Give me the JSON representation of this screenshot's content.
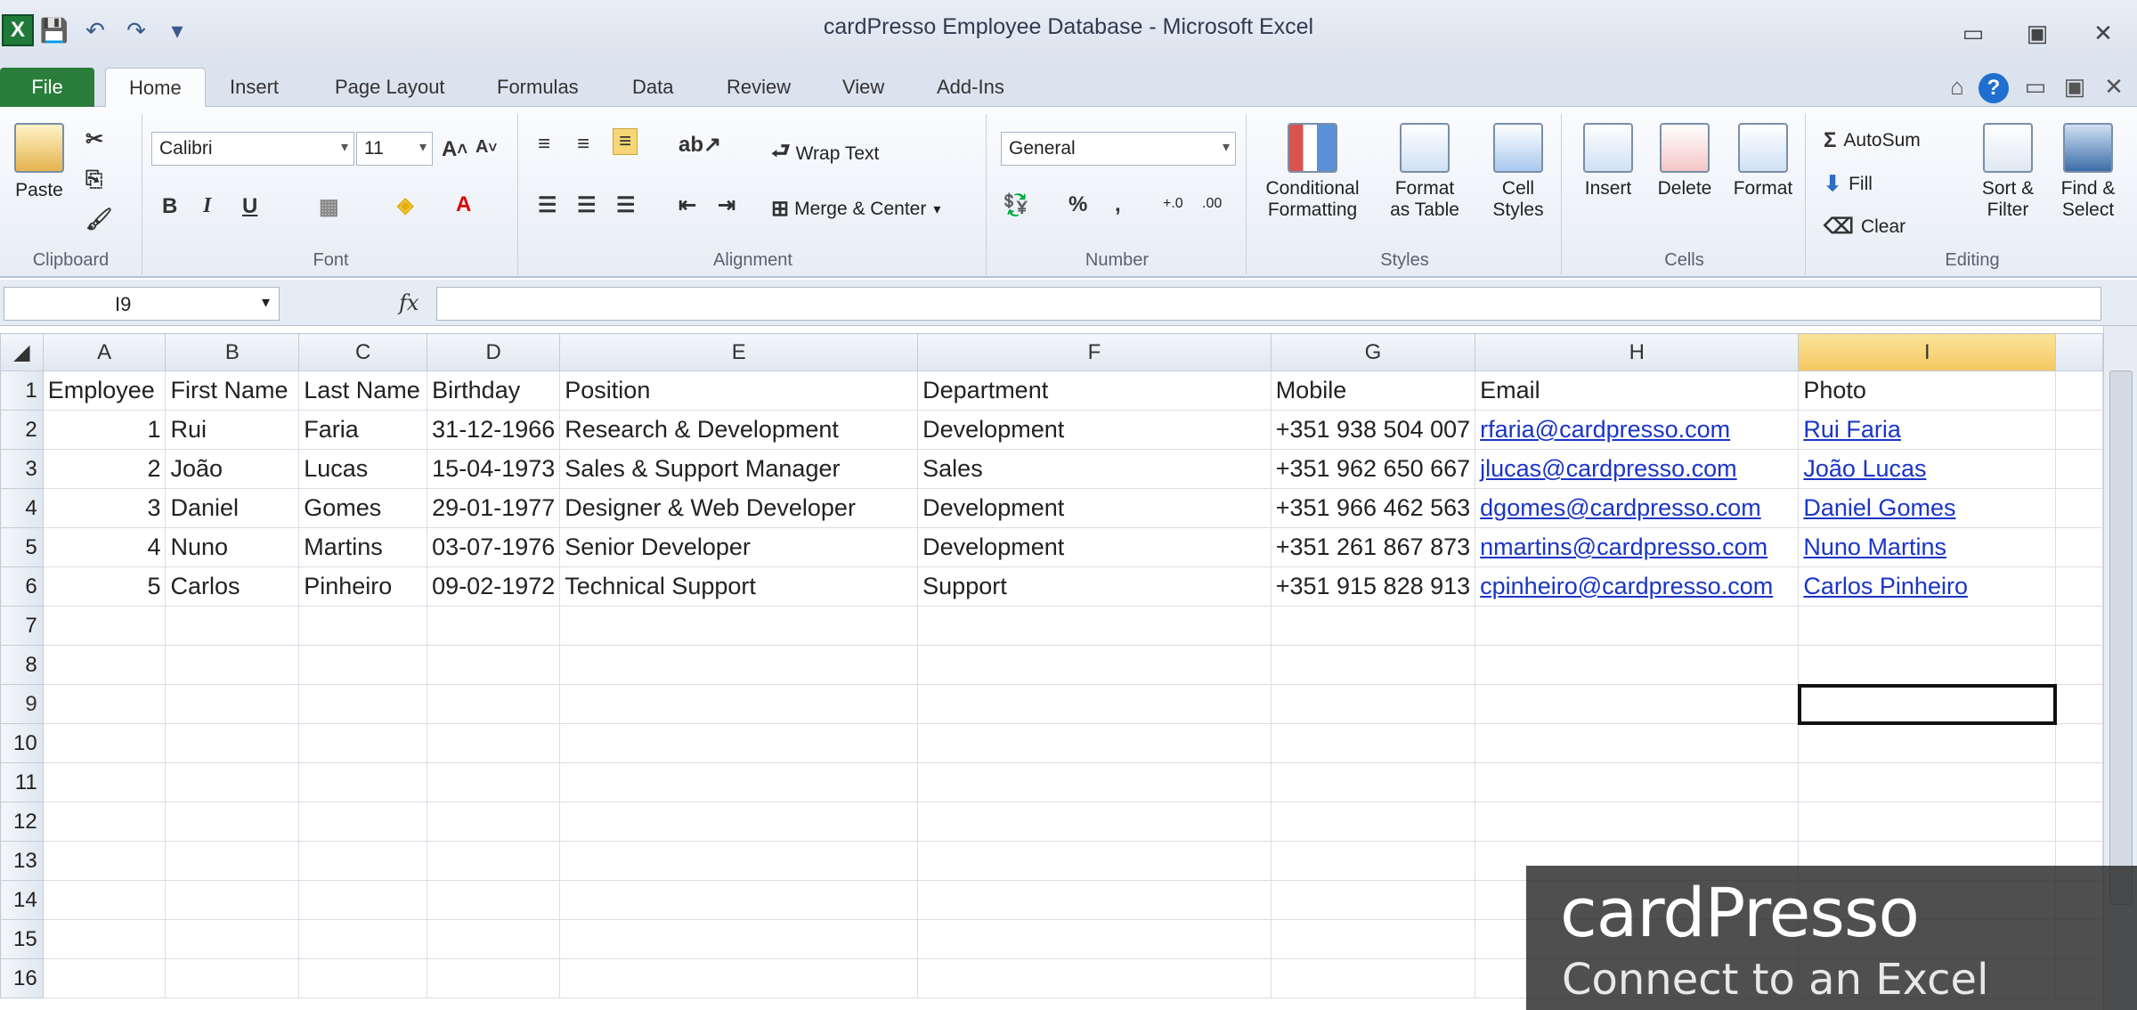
{
  "window": {
    "title": "cardPresso Employee Database  -  Microsoft Excel"
  },
  "tabs": [
    "File",
    "Home",
    "Insert",
    "Page Layout",
    "Formulas",
    "Data",
    "Review",
    "View",
    "Add-Ins"
  ],
  "ribbon": {
    "clipboard": {
      "paste": "Paste",
      "label": "Clipboard"
    },
    "font": {
      "name": "Calibri",
      "size": "11",
      "label": "Font",
      "bold": "B",
      "italic": "I",
      "underline": "U"
    },
    "alignment": {
      "wrap_text": "Wrap Text",
      "merge_center": "Merge & Center",
      "label": "Alignment"
    },
    "number": {
      "format": "General",
      "label": "Number",
      "percent": "%",
      "comma": ","
    },
    "styles": {
      "conditional": "Conditional",
      "conditional2": "Formatting",
      "format_table": "Format",
      "format_table2": "as Table",
      "cell_styles": "Cell",
      "cell_styles2": "Styles",
      "label": "Styles"
    },
    "cells": {
      "insert": "Insert",
      "delete": "Delete",
      "format": "Format",
      "label": "Cells"
    },
    "editing": {
      "autosum": "AutoSum",
      "fill": "Fill",
      "clear": "Clear",
      "sort": "Sort &",
      "sort2": "Filter",
      "find": "Find &",
      "find2": "Select",
      "label": "Editing"
    }
  },
  "formula_bar": {
    "name_box": "I9",
    "fx": "fx",
    "value": ""
  },
  "sheet": {
    "columns": [
      "A",
      "B",
      "C",
      "D",
      "E",
      "F",
      "G",
      "H",
      "I"
    ],
    "row_numbers": [
      "1",
      "2",
      "3",
      "4",
      "5",
      "6",
      "7",
      "8",
      "9",
      "10",
      "11",
      "12",
      "13",
      "14",
      "15",
      "16"
    ],
    "headers": [
      "Employee",
      "First Name",
      "Last Name",
      "Birthday",
      "Position",
      "Department",
      "Mobile",
      "Email",
      "Photo"
    ],
    "rows": [
      [
        "1",
        "Rui",
        "Faria",
        "31-12-1966",
        "Research & Development",
        "Development",
        "+351 938 504 007",
        "rfaria@cardpresso.com",
        "Rui Faria"
      ],
      [
        "2",
        "João",
        "Lucas",
        "15-04-1973",
        "Sales & Support Manager",
        "Sales",
        "+351 962 650 667",
        "jlucas@cardpresso.com",
        "João Lucas"
      ],
      [
        "3",
        "Daniel",
        "Gomes",
        "29-01-1977",
        "Designer & Web Developer",
        "Development",
        "+351 966 462 563",
        "dgomes@cardpresso.com",
        "Daniel Gomes"
      ],
      [
        "4",
        "Nuno",
        "Martins",
        "03-07-1976",
        "Senior Developer",
        "Development",
        "+351 261 867 873",
        "nmartins@cardpresso.com",
        "Nuno Martins"
      ],
      [
        "5",
        "Carlos",
        "Pinheiro",
        "09-02-1972",
        "Technical Support",
        "Support",
        "+351 915 828 913",
        "cpinheiro@cardpresso.com",
        "Carlos Pinheiro"
      ]
    ],
    "active_cell": "I9"
  },
  "watermark": {
    "brand": "cardPresso",
    "subtitle": "Connect to an Excel"
  }
}
